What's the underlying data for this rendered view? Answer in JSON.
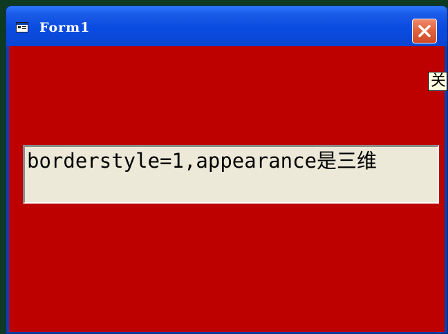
{
  "window": {
    "title": "Form1",
    "icon": "form-icon",
    "close_icon": "close-icon"
  },
  "form": {
    "background_color": "#bd0000",
    "partial_label_text": "关",
    "textbox_value": "borderstyle=1,appearance是三维"
  }
}
